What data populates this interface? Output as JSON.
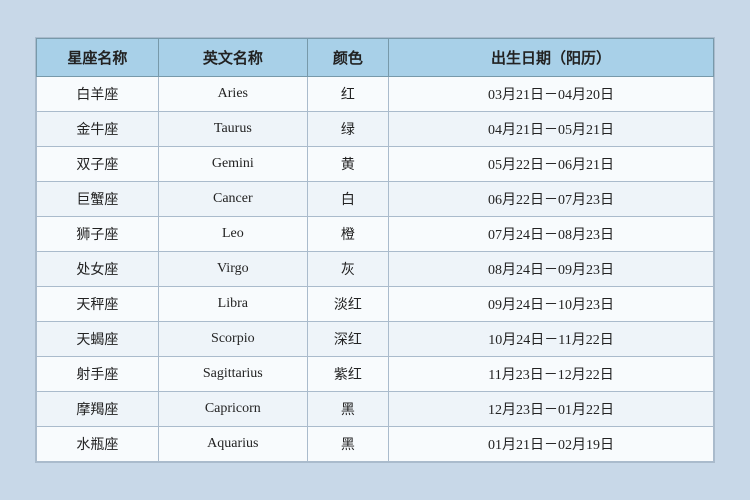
{
  "table": {
    "headers": {
      "zh_name": "星座名称",
      "en_name": "英文名称",
      "color": "颜色",
      "date": "出生日期（阳历）"
    },
    "rows": [
      {
        "zh": "白羊座",
        "en": "Aries",
        "color": "红",
        "date": "03月21日－04月20日"
      },
      {
        "zh": "金牛座",
        "en": "Taurus",
        "color": "绿",
        "date": "04月21日－05月21日"
      },
      {
        "zh": "双子座",
        "en": "Gemini",
        "color": "黄",
        "date": "05月22日－06月21日"
      },
      {
        "zh": "巨蟹座",
        "en": "Cancer",
        "color": "白",
        "date": "06月22日－07月23日"
      },
      {
        "zh": "狮子座",
        "en": "Leo",
        "color": "橙",
        "date": "07月24日－08月23日"
      },
      {
        "zh": "处女座",
        "en": "Virgo",
        "color": "灰",
        "date": "08月24日－09月23日"
      },
      {
        "zh": "天秤座",
        "en": "Libra",
        "color": "淡红",
        "date": "09月24日－10月23日"
      },
      {
        "zh": "天蝎座",
        "en": "Scorpio",
        "color": "深红",
        "date": "10月24日－11月22日"
      },
      {
        "zh": "射手座",
        "en": "Sagittarius",
        "color": "紫红",
        "date": "11月23日－12月22日"
      },
      {
        "zh": "摩羯座",
        "en": "Capricorn",
        "color": "黑",
        "date": "12月23日－01月22日"
      },
      {
        "zh": "水瓶座",
        "en": "Aquarius",
        "color": "黑",
        "date": "01月21日－02月19日"
      }
    ]
  }
}
